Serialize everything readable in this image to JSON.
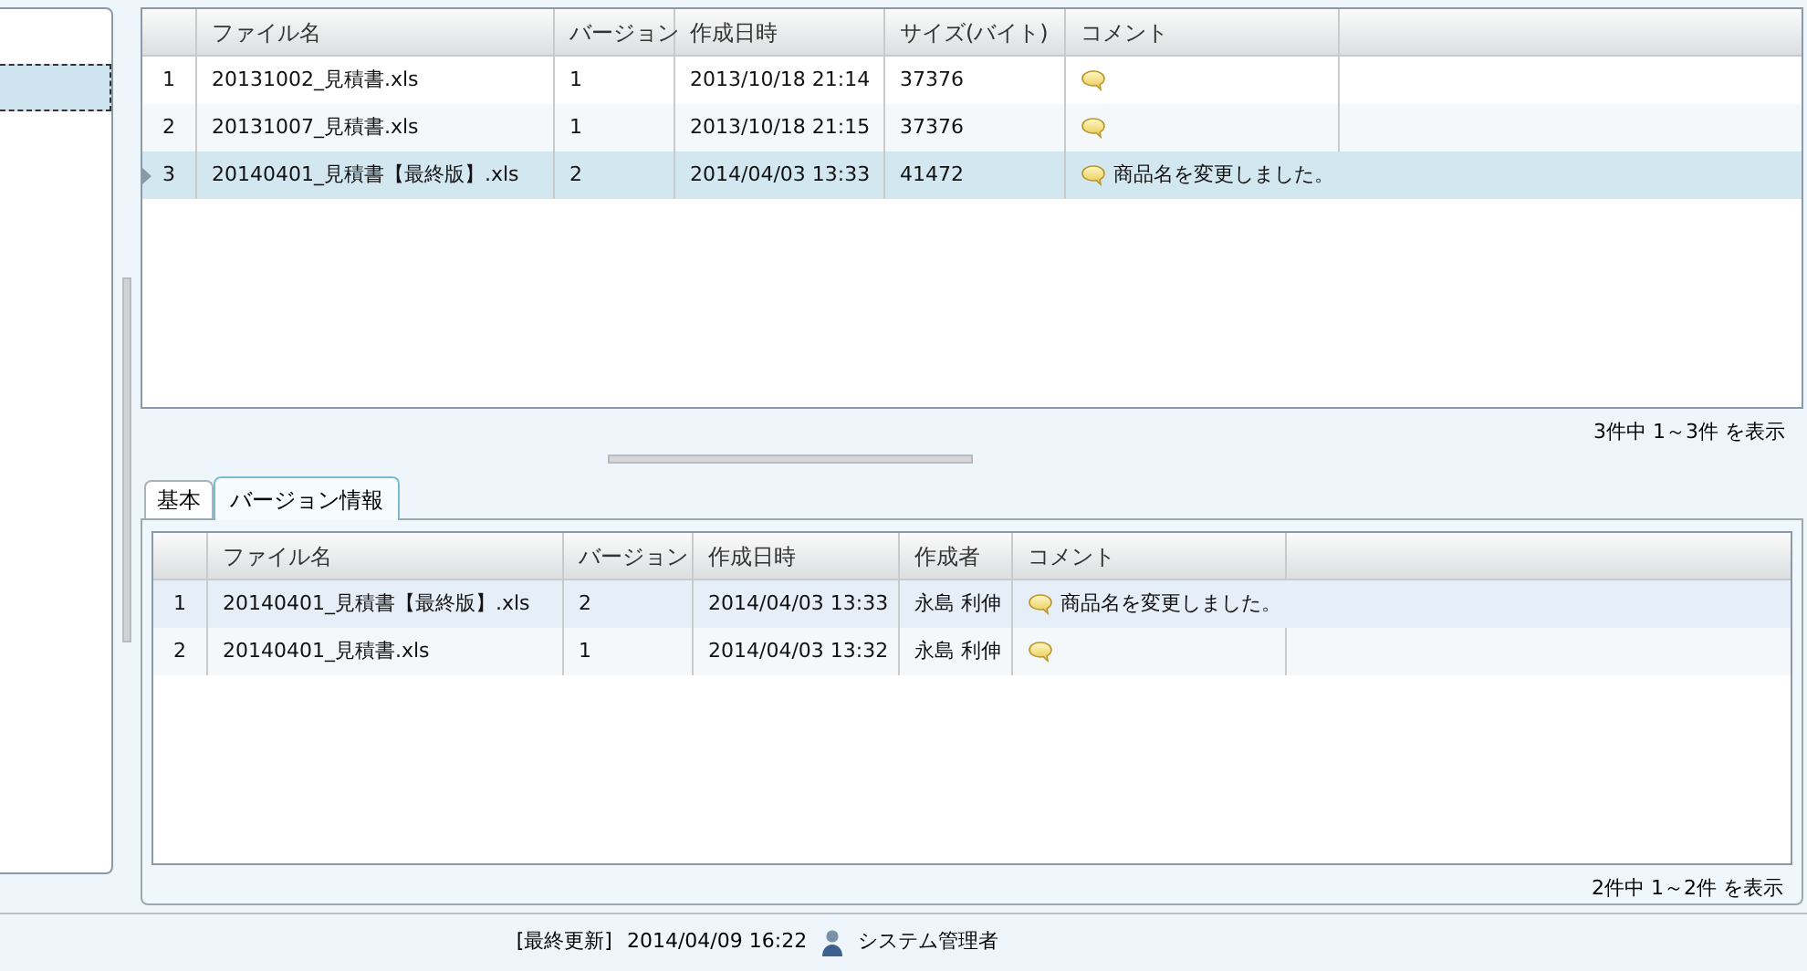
{
  "left_panel": {
    "items": [
      {
        "selected": true
      }
    ]
  },
  "file_grid": {
    "columns": [
      "ファイル名",
      "バージョン",
      "作成日時",
      "サイズ(バイト)",
      "コメント"
    ],
    "rows": [
      {
        "number": "1",
        "cells": [
          "20131002_見積書.xls",
          "1",
          "2013/10/18 21:14",
          "37376",
          ""
        ],
        "selected": false
      },
      {
        "number": "2",
        "cells": [
          "20131007_見積書.xls",
          "1",
          "2013/10/18 21:15",
          "37376",
          ""
        ],
        "selected": false
      },
      {
        "number": "3",
        "cells": [
          "20140401_見積書【最終版】.xls",
          "2",
          "2014/04/03 13:33",
          "41472",
          "商品名を変更しました。"
        ],
        "selected": true
      }
    ],
    "pager": "3件中 1～3件 を表示"
  },
  "tabs": [
    {
      "label": "基本",
      "selected": false
    },
    {
      "label": "バージョン情報",
      "selected": true
    }
  ],
  "version_grid": {
    "columns": [
      "ファイル名",
      "バージョン",
      "作成日時",
      "作成者",
      "コメント"
    ],
    "rows": [
      {
        "number": "1",
        "cells": [
          "20140401_見積書【最終版】.xls",
          "2",
          "2014/04/03 13:33",
          "永島 利伸",
          "商品名を変更しました。"
        ],
        "selected": true
      },
      {
        "number": "2",
        "cells": [
          "20140401_見積書.xls",
          "1",
          "2014/04/03 13:32",
          "永島 利伸",
          ""
        ],
        "selected": false
      }
    ],
    "pager": "2件中 1～2件 を表示"
  },
  "footer": {
    "label": "[最終更新]",
    "timestamp": "2014/04/09 16:22",
    "user": "システム管理者"
  }
}
